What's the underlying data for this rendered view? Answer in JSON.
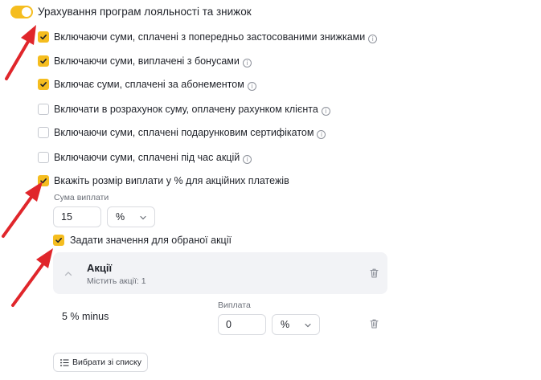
{
  "loyalty": {
    "toggle_label": "Урахування програм лояльності та знижок",
    "toggle_on": true
  },
  "options": [
    {
      "label": "Включаючи суми, сплачені з попередньо застосованими знижками",
      "checked": true
    },
    {
      "label": "Включаючи суми, виплачені з бонусами",
      "checked": true
    },
    {
      "label": "Включає суми, сплачені за абонементом",
      "checked": true
    },
    {
      "label": "Включати в розрахунок суму, оплачену рахунком клієнта",
      "checked": false
    },
    {
      "label": "Включаючи суми, сплачені подарунковим сертифікатом",
      "checked": false
    },
    {
      "label": "Включаючи суми, сплачені під час акцій",
      "checked": false
    },
    {
      "label": "Вкажіть розмір виплати у % для акційних платежів",
      "checked": true
    }
  ],
  "payout": {
    "amount_label": "Сума виплати",
    "amount_value": "15",
    "unit": "%"
  },
  "per_promo": {
    "label": "Задати значення для обраної акції",
    "checked": true
  },
  "promos_group": {
    "title": "Акції",
    "subtitle": "Містить акції: 1"
  },
  "promo_row": {
    "name": "5 % minus",
    "payout_label": "Виплата",
    "payout_value": "0",
    "unit": "%"
  },
  "pick_button_label": "Вибрати зі списку",
  "colors": {
    "accent": "#f5bd1f",
    "arrow": "#e0262b"
  }
}
